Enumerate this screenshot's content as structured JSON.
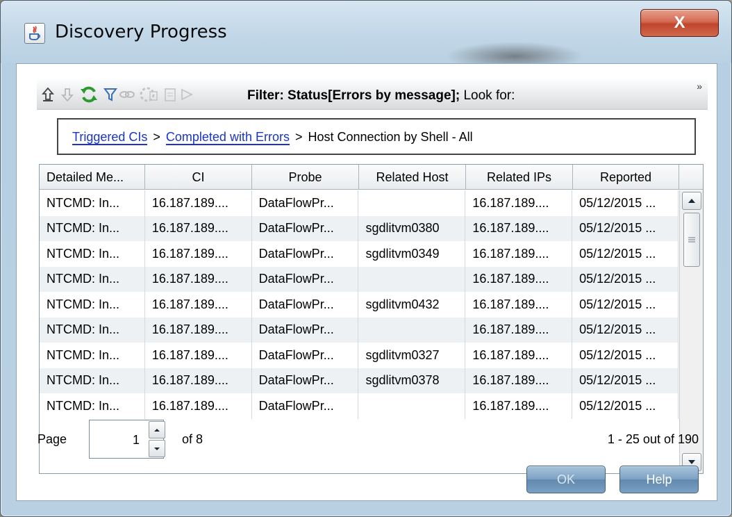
{
  "window": {
    "title": "Discovery Progress",
    "close_label": "X"
  },
  "toolbar": {
    "filter_label": "Filter: Status[Errors by message];",
    "look_for_label": "Look for:",
    "more": "»",
    "icons": [
      "up-arrow-icon",
      "filter-down-icon",
      "refresh-icon",
      "filter-icon",
      "link-icon",
      "grid-icon",
      "document-icon",
      "arrow-right-icon"
    ]
  },
  "breadcrumb": {
    "items": [
      {
        "label": "Triggered CIs",
        "link": true
      },
      {
        "label": "Completed with Errors",
        "link": true
      },
      {
        "label": "Host Connection by Shell - All",
        "link": false
      }
    ],
    "separator": ">"
  },
  "table": {
    "columns": [
      "Detailed Me...",
      "CI",
      "Probe",
      "Related Host",
      "Related IPs",
      "Reported"
    ],
    "rows": [
      [
        "NTCMD: In...",
        "16.187.189....",
        "DataFlowPr...",
        "",
        "16.187.189....",
        "05/12/2015 ..."
      ],
      [
        "NTCMD: In...",
        "16.187.189....",
        "DataFlowPr...",
        "sgdlitvm0380",
        "16.187.189....",
        "05/12/2015 ..."
      ],
      [
        "NTCMD: In...",
        "16.187.189....",
        "DataFlowPr...",
        "sgdlitvm0349",
        "16.187.189....",
        "05/12/2015 ..."
      ],
      [
        "NTCMD: In...",
        "16.187.189....",
        "DataFlowPr...",
        "",
        "16.187.189....",
        "05/12/2015 ..."
      ],
      [
        "NTCMD: In...",
        "16.187.189....",
        "DataFlowPr...",
        "sgdlitvm0432",
        "16.187.189....",
        "05/12/2015 ..."
      ],
      [
        "NTCMD: In...",
        "16.187.189....",
        "DataFlowPr...",
        "",
        "16.187.189....",
        "05/12/2015 ..."
      ],
      [
        "NTCMD: In...",
        "16.187.189....",
        "DataFlowPr...",
        "sgdlitvm0327",
        "16.187.189....",
        "05/12/2015 ..."
      ],
      [
        "NTCMD: In...",
        "16.187.189....",
        "DataFlowPr...",
        "sgdlitvm0378",
        "16.187.189....",
        "05/12/2015 ..."
      ],
      [
        "NTCMD: In...",
        "16.187.189....",
        "DataFlowPr...",
        "",
        "16.187.189....",
        "05/12/2015 ..."
      ]
    ]
  },
  "pager": {
    "page_label": "Page",
    "current_page": "1",
    "of_label": "of 8",
    "record_count": "1 - 25 out of 190"
  },
  "buttons": {
    "ok": "OK",
    "help": "Help"
  },
  "colors": {
    "link": "#1a35c8",
    "close_button": "#c0452b",
    "dialog_button": "#6189ad"
  }
}
